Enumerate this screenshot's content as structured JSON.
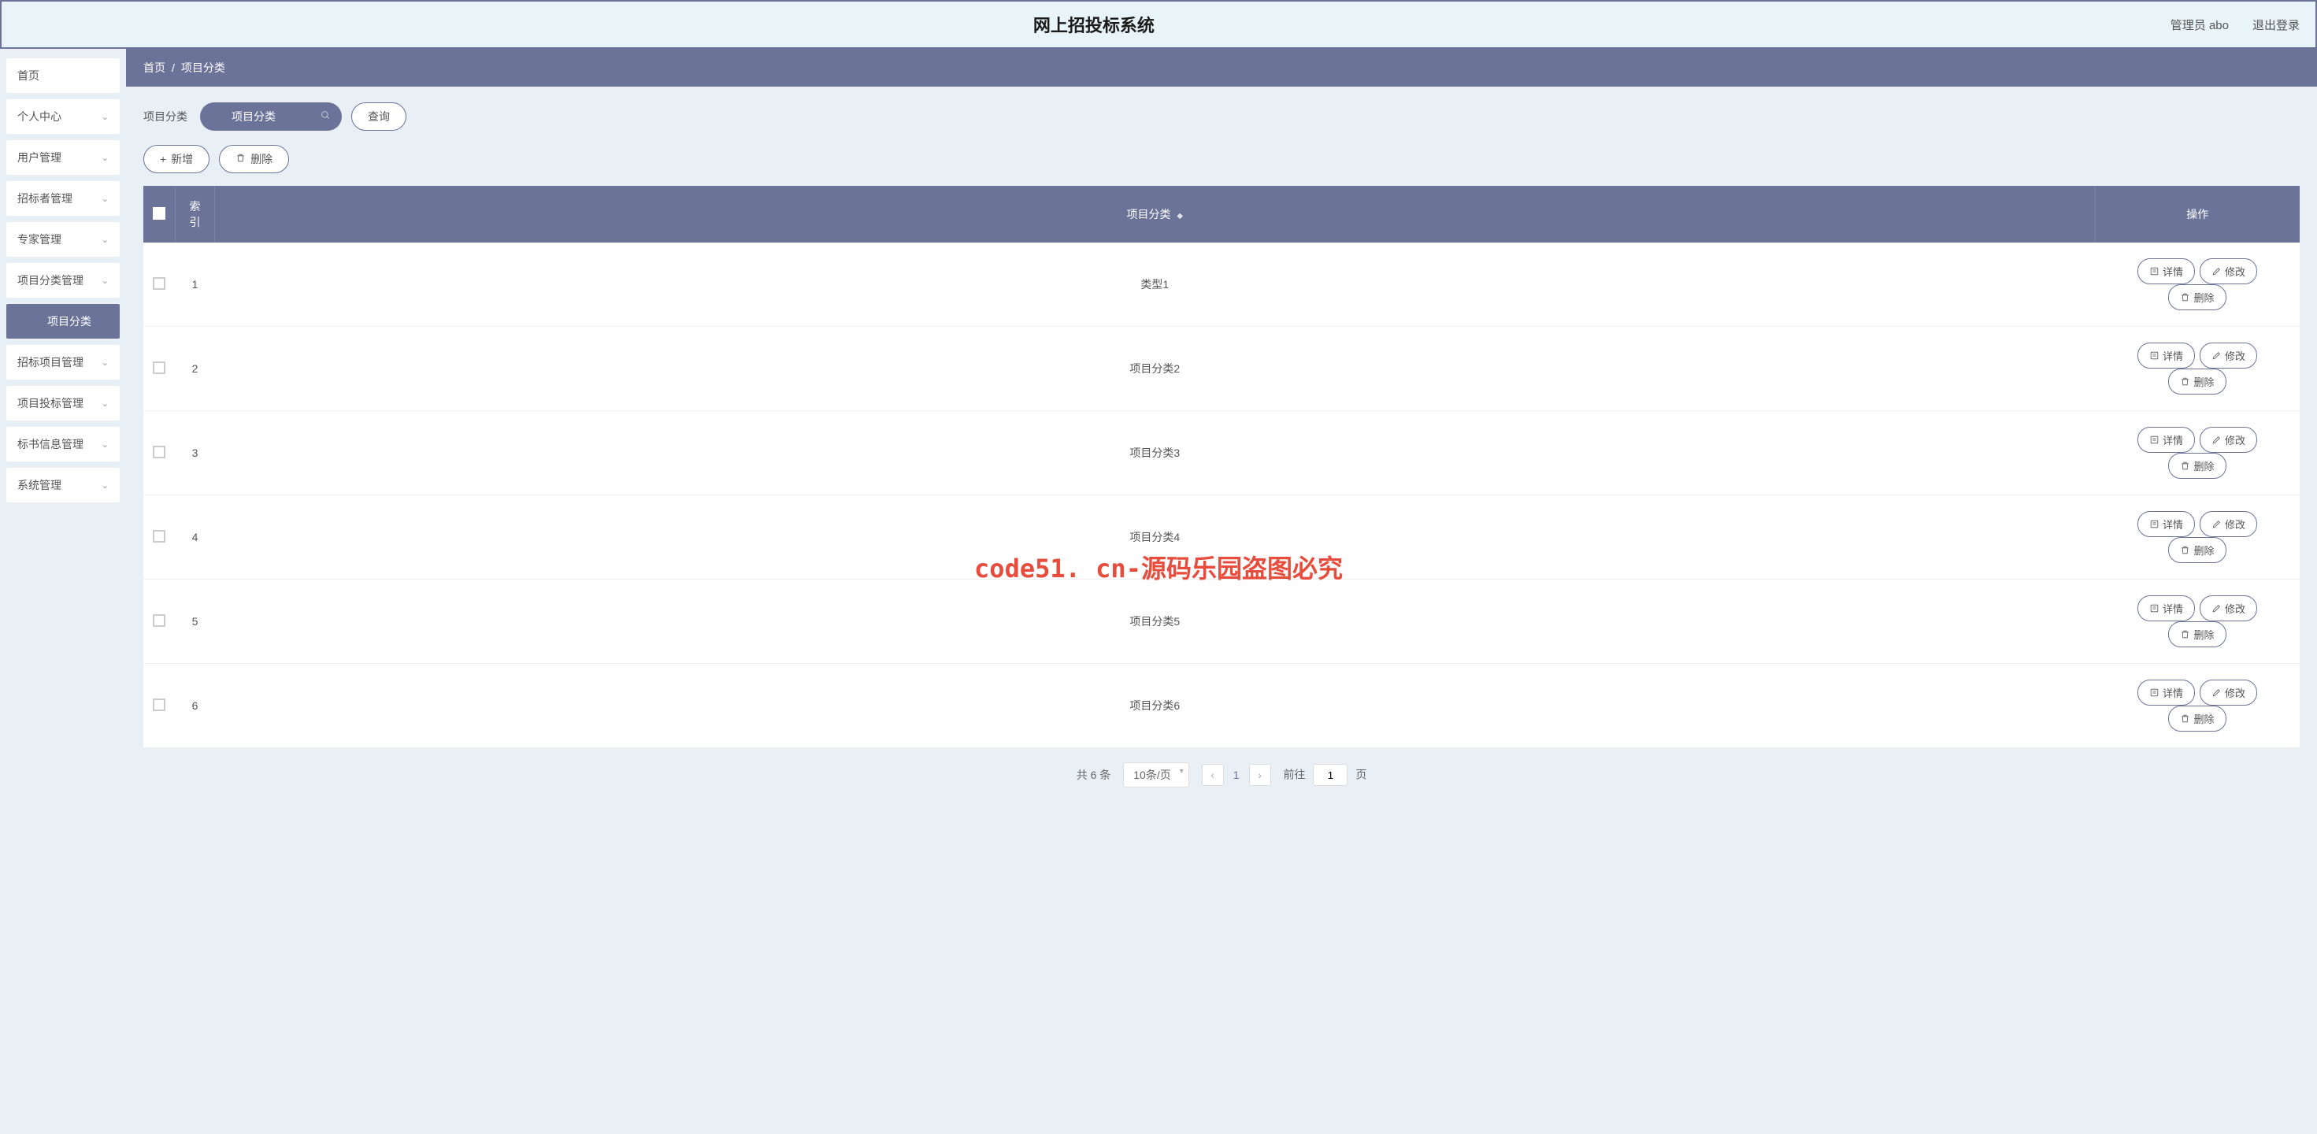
{
  "header": {
    "title": "网上招投标系统",
    "user_label": "管理员 abo",
    "logout": "退出登录"
  },
  "sidebar": {
    "items": [
      {
        "label": "首页",
        "expandable": false
      },
      {
        "label": "个人中心",
        "expandable": true
      },
      {
        "label": "用户管理",
        "expandable": true
      },
      {
        "label": "招标者管理",
        "expandable": true
      },
      {
        "label": "专家管理",
        "expandable": true
      },
      {
        "label": "项目分类管理",
        "expandable": true
      },
      {
        "label": "项目分类",
        "expandable": false,
        "active": true
      },
      {
        "label": "招标项目管理",
        "expandable": true
      },
      {
        "label": "项目投标管理",
        "expandable": true
      },
      {
        "label": "标书信息管理",
        "expandable": true
      },
      {
        "label": "系统管理",
        "expandable": true
      }
    ]
  },
  "breadcrumb": {
    "home": "首页",
    "sep": "/",
    "current": "项目分类"
  },
  "toolbar": {
    "filter_label": "项目分类",
    "search_placeholder": "项目分类",
    "query_btn": "查询",
    "add_btn": "新增",
    "delete_btn": "删除"
  },
  "table": {
    "headers": {
      "index": "索引",
      "category": "项目分类",
      "action": "操作"
    },
    "rows": [
      {
        "index": "1",
        "category": "类型1"
      },
      {
        "index": "2",
        "category": "项目分类2"
      },
      {
        "index": "3",
        "category": "项目分类3"
      },
      {
        "index": "4",
        "category": "项目分类4"
      },
      {
        "index": "5",
        "category": "项目分类5"
      },
      {
        "index": "6",
        "category": "项目分类6"
      }
    ],
    "row_actions": {
      "detail": "详情",
      "edit": "修改",
      "delete": "删除"
    }
  },
  "pagination": {
    "total_label": "共 6 条",
    "page_size": "10条/页",
    "current_page": "1",
    "goto_prefix": "前往",
    "goto_value": "1",
    "goto_suffix": "页"
  },
  "watermark": "code51. cn-源码乐园盗图必究"
}
